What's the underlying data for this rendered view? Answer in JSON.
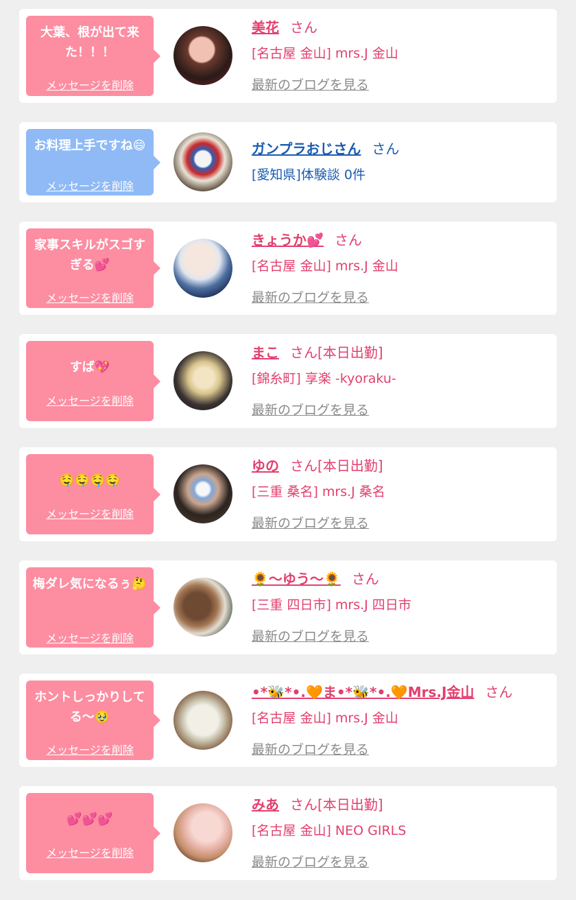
{
  "delete_label": "メッセージを削除",
  "blog_label": "最新のブログを見る",
  "colors": {
    "pink_bubble": "#fd8da1",
    "blue_bubble": "#8fbaf5",
    "pink_text": "#e23f6e",
    "blue_text": "#1a5bb0"
  },
  "messages": [
    {
      "bubble_text": "大葉、根が出て来た！！！",
      "name": "美花",
      "suffix": "さん",
      "shop": "[名古屋 金山] mrs.J 金山",
      "blog": true,
      "theme": "pink"
    },
    {
      "bubble_text": "お料理上手ですね😄",
      "name": "ガンプラおじさん",
      "suffix": "さん",
      "shop": "[愛知県]体験談 0件",
      "blog": false,
      "theme": "blue"
    },
    {
      "bubble_text": "家事スキルがスゴすぎる💕",
      "name": "きょうか💕",
      "suffix": "さん",
      "shop": "[名古屋 金山] mrs.J 金山",
      "blog": true,
      "theme": "pink"
    },
    {
      "bubble_text": "すば💖",
      "name": "まこ",
      "suffix": "さん[本日出勤]",
      "shop": "[錦糸町] 享楽 -kyoraku-",
      "blog": true,
      "theme": "pink"
    },
    {
      "bubble_text": "🤤🤤🤤🤤",
      "name": "ゆの",
      "suffix": "さん[本日出勤]",
      "shop": "[三重 桑名] mrs.J 桑名",
      "blog": true,
      "theme": "pink"
    },
    {
      "bubble_text": "梅ダレ気になるぅ🤔",
      "name": "🌻〜ゆう〜🌻",
      "suffix": "さん",
      "shop": "[三重 四日市] mrs.J 四日市",
      "blog": true,
      "theme": "pink"
    },
    {
      "bubble_text": "ホントしっかりしてる〜🥹",
      "name": "•*🐝*•.🧡ま•*🐝*•.🧡Mrs.J金山",
      "suffix": "さん",
      "shop": "[名古屋 金山] mrs.J 金山",
      "blog": true,
      "theme": "pink"
    },
    {
      "bubble_text": "💕💕💕",
      "name": "みあ",
      "suffix": "さん[本日出勤]",
      "shop": "[名古屋 金山] NEO GIRLS",
      "blog": true,
      "theme": "pink"
    }
  ]
}
